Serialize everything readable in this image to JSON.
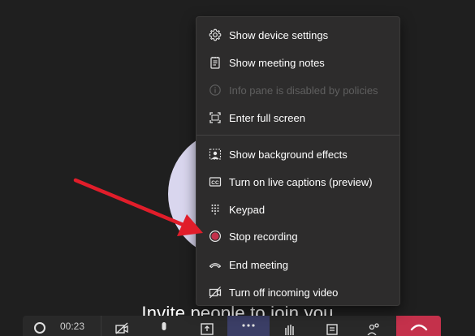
{
  "background": {
    "invite_text": "Invite people to join you"
  },
  "toolbar": {
    "timer": "00:23"
  },
  "menu": {
    "items": [
      {
        "label": "Show device settings",
        "icon": "gear-icon",
        "enabled": true
      },
      {
        "label": "Show meeting notes",
        "icon": "notes-icon",
        "enabled": true
      },
      {
        "label": "Info pane is disabled by policies",
        "icon": "info-icon",
        "enabled": false
      },
      {
        "label": "Enter full screen",
        "icon": "fullscreen-icon",
        "enabled": true
      },
      {
        "label": "Show background effects",
        "icon": "background-effects-icon",
        "enabled": true
      },
      {
        "label": "Turn on live captions (preview)",
        "icon": "captions-icon",
        "enabled": true
      },
      {
        "label": "Keypad",
        "icon": "keypad-icon",
        "enabled": true
      },
      {
        "label": "Stop recording",
        "icon": "record-dot-icon",
        "enabled": true
      },
      {
        "label": "End meeting",
        "icon": "end-meeting-icon",
        "enabled": true
      },
      {
        "label": "Turn off incoming video",
        "icon": "video-off-icon",
        "enabled": true
      }
    ]
  },
  "colors": {
    "menu_bg": "#2d2c2c",
    "page_bg": "#1f1f1f",
    "avatar": "#d9d6ee",
    "record_red": "#c4314b",
    "arrow_red": "#e11d2a",
    "hangup": "#c4314b",
    "active_button": "#3b3e66"
  }
}
